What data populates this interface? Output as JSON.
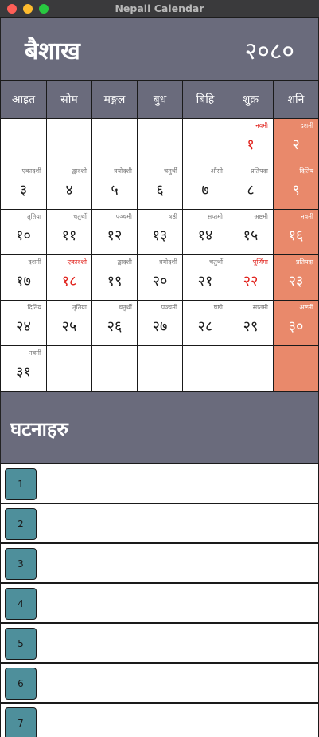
{
  "window": {
    "title": "Nepali Calendar"
  },
  "header": {
    "month": "बैशाख",
    "year": "२०८०"
  },
  "weekdays": [
    "आइत",
    "सोम",
    "मङ्गल",
    "बुध",
    "बिहि",
    "शुक्र",
    "शनि"
  ],
  "weeks": [
    [
      {
        "day": "",
        "tithi": ""
      },
      {
        "day": "",
        "tithi": ""
      },
      {
        "day": "",
        "tithi": ""
      },
      {
        "day": "",
        "tithi": ""
      },
      {
        "day": "",
        "tithi": ""
      },
      {
        "day": "१",
        "tithi": "नवमी",
        "holiday": true
      },
      {
        "day": "२",
        "tithi": "दशमी"
      }
    ],
    [
      {
        "day": "३",
        "tithi": "एकादशी"
      },
      {
        "day": "४",
        "tithi": "द्वादशी"
      },
      {
        "day": "५",
        "tithi": "त्रयोदशी"
      },
      {
        "day": "६",
        "tithi": "चतुर्थी"
      },
      {
        "day": "७",
        "tithi": "औंसी"
      },
      {
        "day": "८",
        "tithi": "प्रतिपदा"
      },
      {
        "day": "९",
        "tithi": "दितिय"
      }
    ],
    [
      {
        "day": "१०",
        "tithi": "तृतिया"
      },
      {
        "day": "११",
        "tithi": "चतुर्थी"
      },
      {
        "day": "१२",
        "tithi": "पञ्चमी"
      },
      {
        "day": "१३",
        "tithi": "षष्ठी"
      },
      {
        "day": "१४",
        "tithi": "सप्तमी"
      },
      {
        "day": "१५",
        "tithi": "अष्टमी"
      },
      {
        "day": "१६",
        "tithi": "नवमी"
      }
    ],
    [
      {
        "day": "१७",
        "tithi": "दशमी"
      },
      {
        "day": "१८",
        "tithi": "एकादशी",
        "holiday": true
      },
      {
        "day": "१९",
        "tithi": "द्वादशी"
      },
      {
        "day": "२०",
        "tithi": "त्रयोदशी"
      },
      {
        "day": "२१",
        "tithi": "चतुर्थी"
      },
      {
        "day": "२२",
        "tithi": "पूर्णिमा",
        "holiday": true
      },
      {
        "day": "२३",
        "tithi": "प्रतिपदा"
      }
    ],
    [
      {
        "day": "२४",
        "tithi": "दितिय"
      },
      {
        "day": "२५",
        "tithi": "तृतिया"
      },
      {
        "day": "२६",
        "tithi": "चतुर्थी"
      },
      {
        "day": "२७",
        "tithi": "पञ्चमी"
      },
      {
        "day": "२८",
        "tithi": "षष्ठी"
      },
      {
        "day": "२९",
        "tithi": "सप्तमी"
      },
      {
        "day": "३०",
        "tithi": "अष्टमी"
      }
    ],
    [
      {
        "day": "३१",
        "tithi": "नवमी"
      },
      {
        "day": "",
        "tithi": ""
      },
      {
        "day": "",
        "tithi": ""
      },
      {
        "day": "",
        "tithi": ""
      },
      {
        "day": "",
        "tithi": ""
      },
      {
        "day": "",
        "tithi": ""
      },
      {
        "day": "",
        "tithi": ""
      }
    ]
  ],
  "events": {
    "title": "घटनाहरु",
    "items": [
      "1",
      "2",
      "3",
      "4",
      "5",
      "6",
      "7"
    ]
  },
  "colors": {
    "header_bg": "#6a6b7c",
    "saturday_bg": "#e9896b",
    "holiday_text": "#e0201a",
    "event_button": "#4e8f9b"
  }
}
